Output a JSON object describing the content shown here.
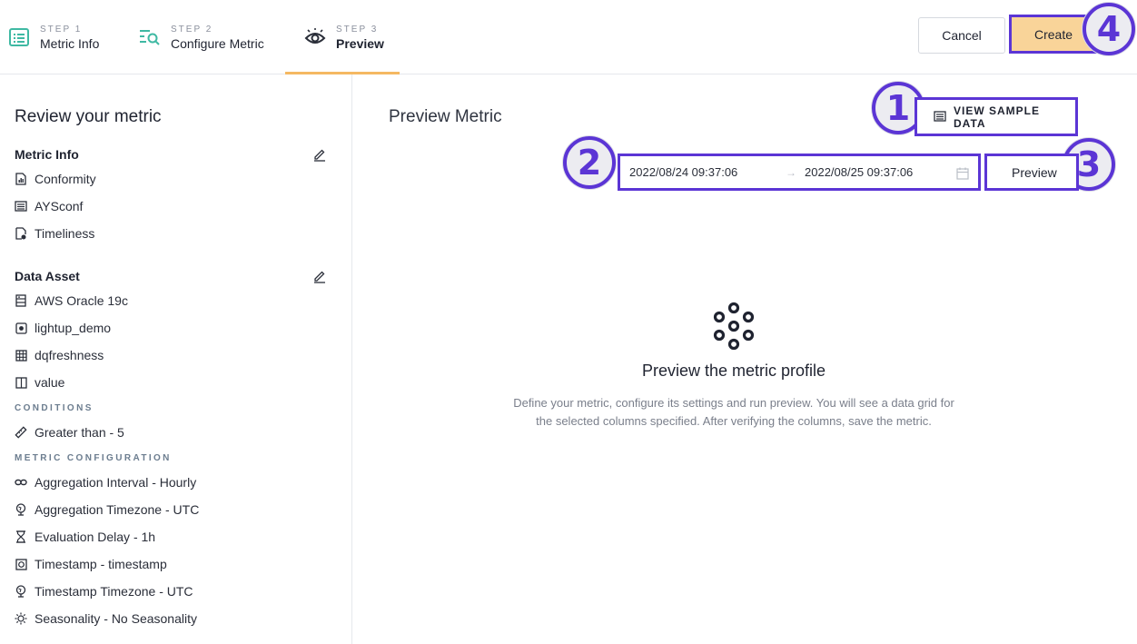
{
  "header": {
    "steps": [
      {
        "step": "STEP 1",
        "name": "Metric Info",
        "icon": "metric-info-icon"
      },
      {
        "step": "STEP 2",
        "name": "Configure Metric",
        "icon": "configure-search-icon"
      },
      {
        "step": "STEP 3",
        "name": "Preview",
        "icon": "eye-icon",
        "active": true
      }
    ],
    "cancel_label": "Cancel",
    "create_label": "Create",
    "accent_color": "#f5b862",
    "highlight_color": "#5b35d5"
  },
  "badges": [
    "1",
    "2",
    "3",
    "4"
  ],
  "sidebar": {
    "title": "Review your metric",
    "metric_info": {
      "title": "Metric Info",
      "items": [
        {
          "label": "Conformity",
          "icon": "chart-file-icon"
        },
        {
          "label": "AYSconf",
          "icon": "list-icon"
        },
        {
          "label": "Timeliness",
          "icon": "doc-clock-icon"
        }
      ]
    },
    "data_asset": {
      "title": "Data Asset",
      "items": [
        {
          "label": "AWS Oracle 19c",
          "icon": "database-icon"
        },
        {
          "label": "lightup_demo",
          "icon": "schema-icon"
        },
        {
          "label": "dqfreshness",
          "icon": "table-icon"
        },
        {
          "label": "value",
          "icon": "column-icon"
        }
      ]
    },
    "conditions": {
      "title": "CONDITIONS",
      "items": [
        {
          "label": "Greater than - 5",
          "icon": "ruler-icon"
        }
      ]
    },
    "metric_configuration": {
      "title": "METRIC CONFIGURATION",
      "items": [
        {
          "label": "Aggregation Interval - Hourly",
          "icon": "link-icon"
        },
        {
          "label": "Aggregation Timezone - UTC",
          "icon": "globe-icon"
        },
        {
          "label": "Evaluation Delay - 1h",
          "icon": "hourglass-icon"
        },
        {
          "label": "Timestamp - timestamp",
          "icon": "timestamp-icon"
        },
        {
          "label": "Timestamp Timezone - UTC",
          "icon": "globe-icon"
        },
        {
          "label": "Seasonality - No Seasonality",
          "icon": "sun-icon"
        }
      ]
    }
  },
  "main": {
    "title": "Preview Metric",
    "sample_label": "VIEW SAMPLE DATA",
    "range_from": "2022/08/24 09:37:06",
    "range_arrow": "→",
    "range_to": "2022/08/25 09:37:06",
    "preview_label": "Preview",
    "empty_title": "Preview the metric profile",
    "empty_desc": "Define your metric, configure its settings and run preview. You will see a data grid for the selected columns specified. After verifying the columns, save the metric."
  }
}
